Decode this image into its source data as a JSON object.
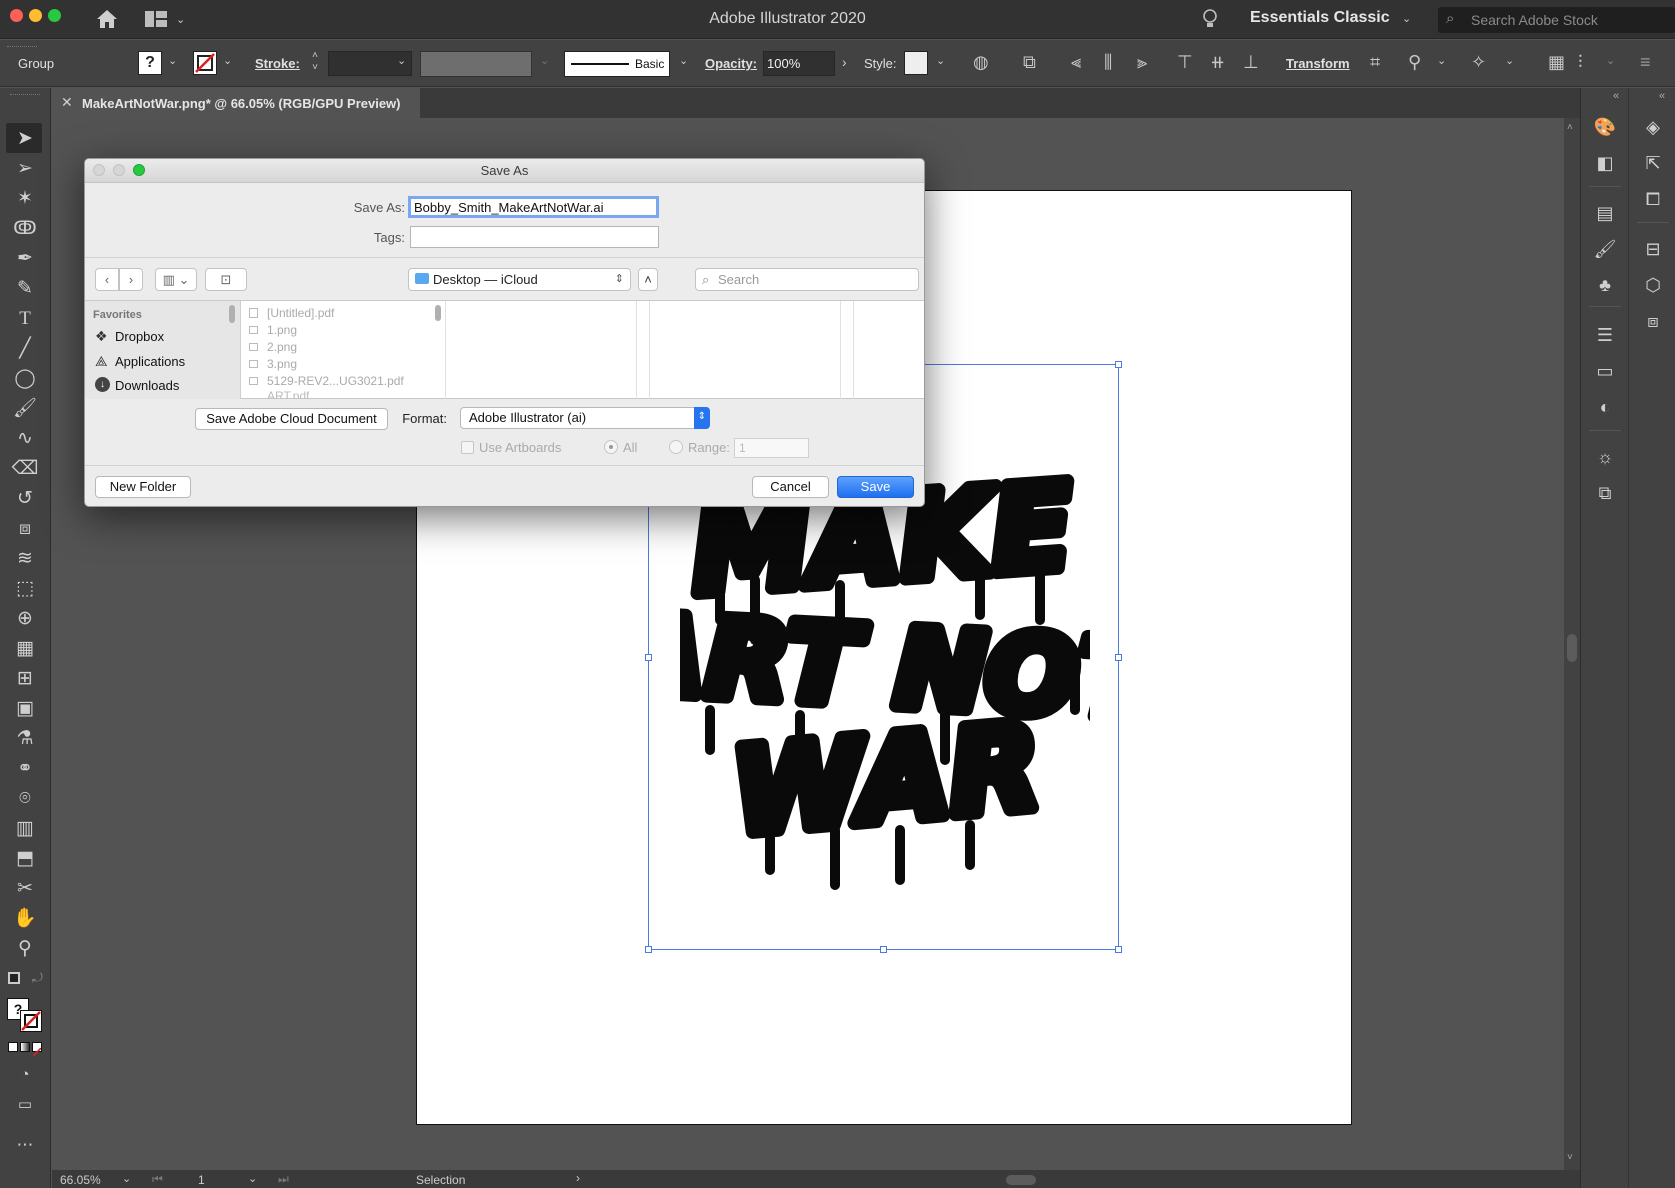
{
  "app": {
    "title": "Adobe Illustrator 2020",
    "workspace": "Essentials Classic",
    "stock_search_placeholder": "Search Adobe Stock"
  },
  "control_bar": {
    "selection_type": "Group",
    "fill_symbol": "?",
    "stroke_label": "Stroke:",
    "brush_label": "Basic",
    "opacity_label": "Opacity:",
    "opacity_value": "100%",
    "style_label": "Style:",
    "transform_label": "Transform"
  },
  "document": {
    "tab_title": "MakeArtNotWar.png* @ 66.05% (RGB/GPU Preview)",
    "close_symbol": "✕"
  },
  "dialog": {
    "title": "Save As",
    "save_as_label": "Save As:",
    "save_as_value": "Bobby_Smith_MakeArtNotWar.ai",
    "tags_label": "Tags:",
    "location": "Desktop — iCloud",
    "search_placeholder": "Search",
    "favorites_header": "Favorites",
    "favorites": [
      "Dropbox",
      "Applications",
      "Downloads"
    ],
    "files": [
      "[Untitled].pdf",
      "1.png",
      "2.png",
      "3.png",
      "5129-REV2...UG3021.pdf",
      "ART.pdf"
    ],
    "cloud_button": "Save Adobe Cloud Document",
    "format_label": "Format:",
    "format_value": "Adobe Illustrator (ai)",
    "use_artboards": "Use Artboards",
    "all_label": "All",
    "range_label": "Range:",
    "range_value": "1",
    "new_folder": "New Folder",
    "cancel": "Cancel",
    "save": "Save"
  },
  "artwork": {
    "lines": [
      "MAKE",
      "ART NOT",
      "WAR"
    ]
  },
  "status": {
    "zoom": "66.05%",
    "artboard_number": "1",
    "tool": "Selection"
  },
  "colors": {
    "accent": "#1e6ff0",
    "selection": "#4a7be0",
    "canvas": "#535353",
    "panel": "#424242"
  }
}
